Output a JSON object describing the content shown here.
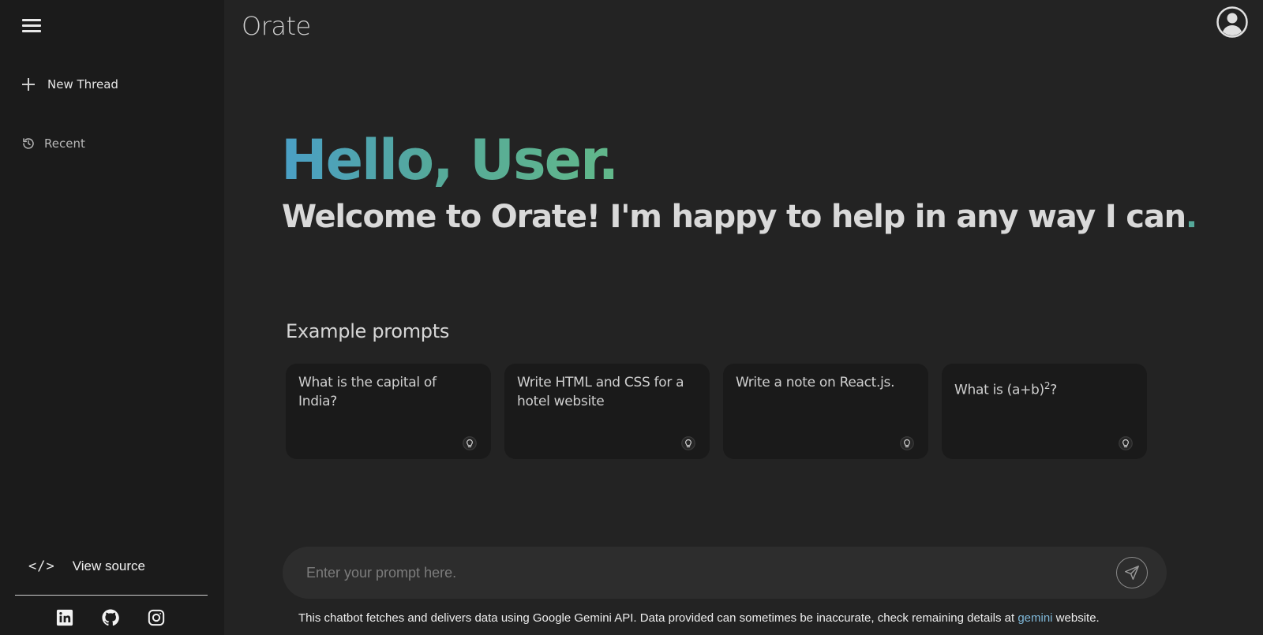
{
  "app": {
    "title": "Orate"
  },
  "sidebar": {
    "new_thread_label": "New Thread",
    "recent_label": "Recent",
    "view_source_label": "View source",
    "view_source_icon": "</>",
    "socials": [
      "linkedin-icon",
      "github-icon",
      "instagram-icon"
    ]
  },
  "hero": {
    "greeting": "Hello, User.",
    "welcome": "Welcome to Orate! I'm happy to help in any way I can",
    "welcome_dot": ".",
    "gradient_colors": [
      "#4a9fc6",
      "#55a99a",
      "#62b88a"
    ]
  },
  "examples": {
    "heading": "Example prompts",
    "cards": [
      {
        "text": "What is the capital of India?"
      },
      {
        "text": "Write HTML and CSS for a hotel website"
      },
      {
        "text": "Write a note on React.js."
      },
      {
        "text_before": "What is (a+b)",
        "sup": "2",
        "text_after": "?"
      }
    ]
  },
  "prompt": {
    "placeholder": "Enter your prompt here.",
    "value": ""
  },
  "footer": {
    "disclaimer_before": "This chatbot fetches and delivers data using Google Gemini API. Data provided can sometimes be inaccurate, check remaining details at ",
    "link_text": "gemini",
    "disclaimer_after": " website."
  },
  "colors": {
    "background": "#232323",
    "sidebar": "#1b1b1b",
    "card": "#1a1a1a",
    "accent": "#55a99a",
    "link": "#7fb8d9"
  }
}
